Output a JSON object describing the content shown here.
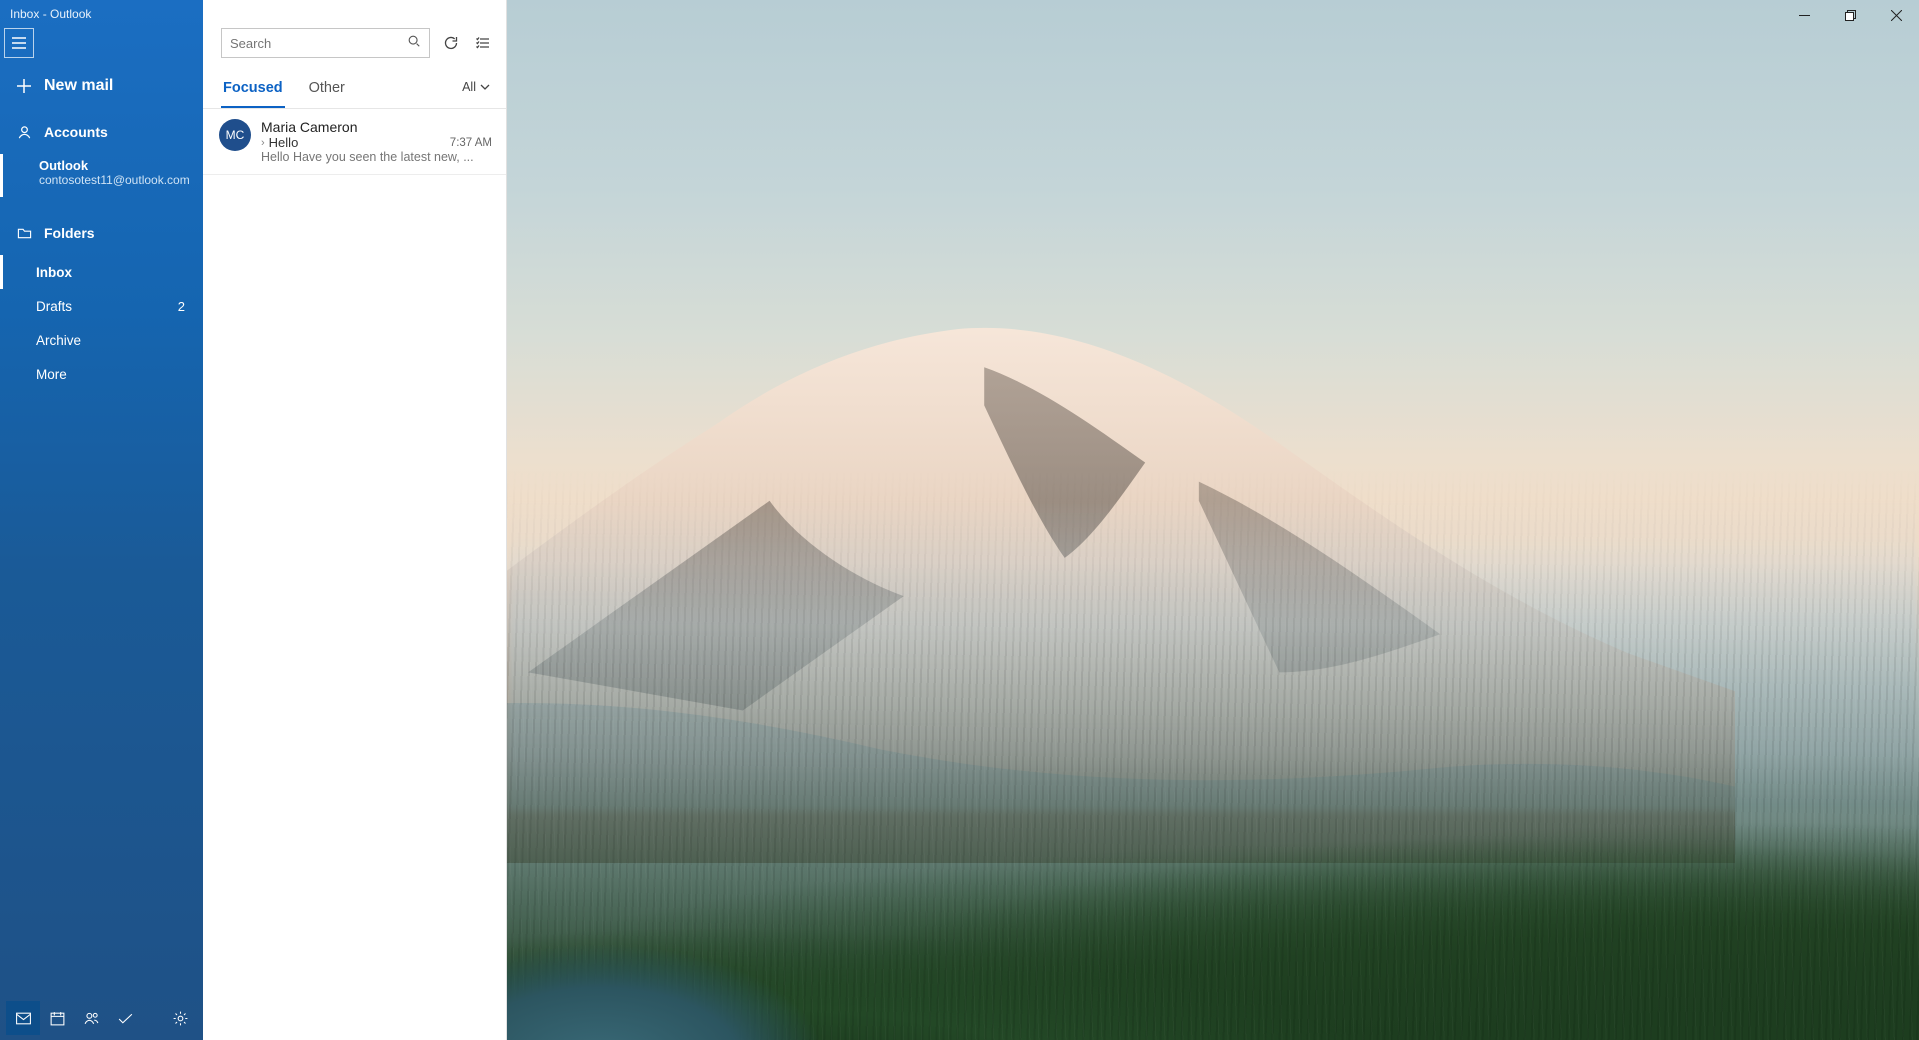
{
  "window": {
    "title": "Inbox - Outlook"
  },
  "sidebar": {
    "new_mail_label": "New mail",
    "accounts_header": "Accounts",
    "account": {
      "name": "Outlook",
      "email": "contosotest11@outlook.com"
    },
    "folders_header": "Folders",
    "folders": [
      {
        "label": "Inbox",
        "count": "",
        "active": true
      },
      {
        "label": "Drafts",
        "count": "2",
        "active": false
      },
      {
        "label": "Archive",
        "count": "",
        "active": false
      },
      {
        "label": "More",
        "count": "",
        "active": false
      }
    ]
  },
  "list": {
    "search_placeholder": "Search",
    "tabs": {
      "focused": "Focused",
      "other": "Other"
    },
    "filter_label": "All",
    "messages": [
      {
        "initials": "MC",
        "sender": "Maria Cameron",
        "subject": "Hello",
        "preview": "Hello Have you seen the latest new, ...",
        "time": "7:37 AM"
      }
    ]
  }
}
